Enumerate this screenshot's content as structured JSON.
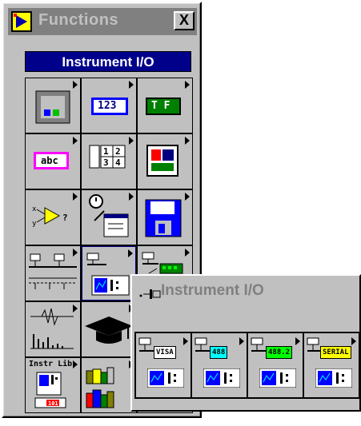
{
  "window": {
    "title": "Functions",
    "close_label": "X",
    "icon": "labview-app-icon"
  },
  "palette": {
    "category": "Instrument I/O",
    "grid_icons": [
      "structures-icon",
      "numeric-icon",
      "boolean-icon",
      "string-icon",
      "array-cluster-icon",
      "comparison-icon",
      "advanced-icon",
      "time-dialog-icon",
      "file-io-icon",
      "instrument-io-icon",
      "instrument-io-icon",
      "data-acquisition-icon",
      "analysis-icon",
      "tutorial-icon",
      "communication-icon",
      "instrument-library-icon",
      "vi-library-icon",
      "select-vi-icon"
    ],
    "numeric_text": "123",
    "boolean_text": "T F",
    "string_text": "abc",
    "array_text": [
      "1",
      "2",
      "3",
      "4"
    ],
    "instr_lib_text": "Instr Lib",
    "instr_lib_badge": "101",
    "select_vi_text": "..."
  },
  "subpalette": {
    "title": "Instrument I/O",
    "items": [
      {
        "name": "visa",
        "label": "VISA"
      },
      {
        "name": "gpib",
        "label": "488"
      },
      {
        "name": "gpib-488-2",
        "label": "488.2"
      },
      {
        "name": "serial",
        "label": "SERIAL"
      }
    ]
  },
  "colors": {
    "title_bar": "#808080",
    "category_header": "#00008b",
    "face": "#c0c0c0",
    "numeric_border": "#0000ff",
    "boolean_fill": "#008000",
    "string_border": "#ff00ff",
    "gpib_label_bg": "#00ffff",
    "gpib2_label_bg": "#00ff00",
    "serial_label_bg": "#ffff00"
  }
}
